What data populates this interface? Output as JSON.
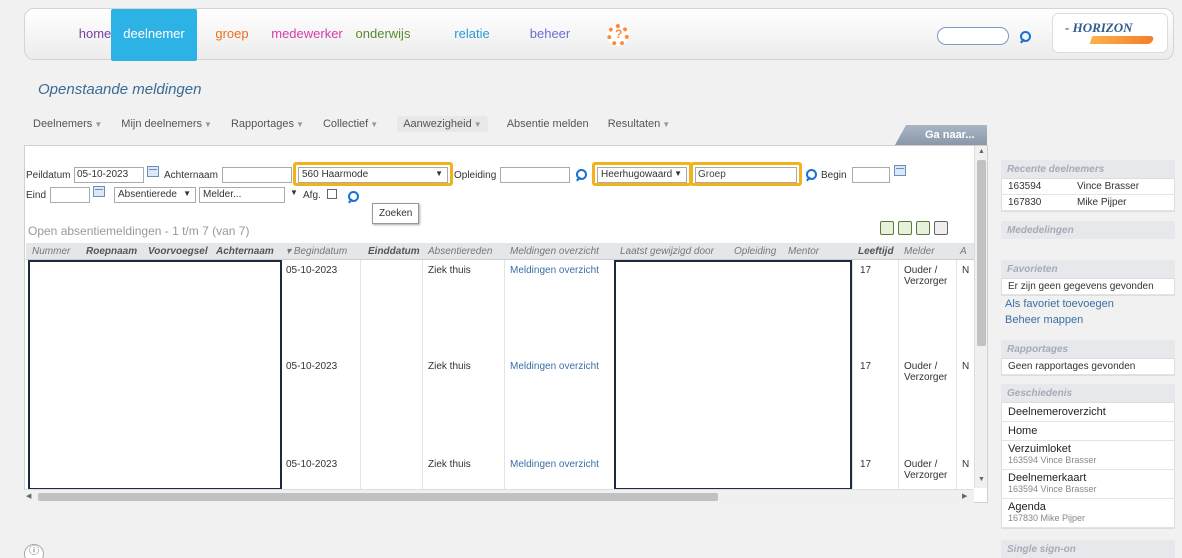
{
  "nav": {
    "items": [
      {
        "label": "home",
        "color": "#7a3fa8"
      },
      {
        "label": "deelnemer",
        "color": "#ffffff"
      },
      {
        "label": "groep",
        "color": "#e8711c"
      },
      {
        "label": "medewerker",
        "color": "#d23fa8"
      },
      {
        "label": "onderwijs",
        "color": "#5c8a2e"
      },
      {
        "label": "relatie",
        "color": "#2d9bd3"
      },
      {
        "label": "beheer",
        "color": "#6c6cd8"
      }
    ],
    "help_icon": "help-lifebuoy-icon",
    "search_placeholder": "",
    "logo_text": "- HORIZON"
  },
  "page": {
    "title": "Openstaande meldingen"
  },
  "subnav": {
    "items": [
      "Deelnemers",
      "Mijn deelnemers",
      "Rapportages",
      "Collectief",
      "Aanwezigheid",
      "Absentie melden",
      "Resultaten"
    ],
    "goto": "Ga naar..."
  },
  "filters": {
    "peildatum_label": "Peildatum",
    "peildatum_value": "05-10-2023",
    "achternaam_label": "Achternaam",
    "achternaam_value": "",
    "locatie_value": "560 Haarmode",
    "opleiding_label": "Opleiding",
    "vestiging_value": "Heerhugowaard",
    "groep_placeholder": "Groep",
    "begin_label": "Begin",
    "eind_label": "Eind",
    "absentiereden_value": "Absentierede",
    "melder_value": "Melder...",
    "afg_label": "Afg.",
    "tooltip": "Zoeken"
  },
  "list": {
    "title": "Open absentiemeldingen - 1 t/m 7 (van 7)",
    "columns": [
      "Nummer",
      "Roepnaam",
      "Voorvoegsel",
      "Achternaam",
      "Begindatum",
      "Einddatum",
      "Absentiereden",
      "Meldingen overzicht",
      "Laatst gewijzigd door",
      "Opleiding",
      "Mentor",
      "Leeftijd",
      "Melder",
      "A"
    ],
    "rows": [
      {
        "begindatum": "05-10-2023",
        "reden": "Ziek thuis",
        "overzicht": "Meldingen overzicht",
        "leeftijd": "17",
        "melder": "Ouder / Verzorger",
        "a": "N"
      },
      {
        "begindatum": "05-10-2023",
        "reden": "Ziek thuis",
        "overzicht": "Meldingen overzicht",
        "leeftijd": "17",
        "melder": "Ouder / Verzorger",
        "a": "N"
      },
      {
        "begindatum": "05-10-2023",
        "reden": "Ziek thuis",
        "overzicht": "Meldingen overzicht",
        "leeftijd": "17",
        "melder": "Ouder / Verzorger",
        "a": "N"
      }
    ]
  },
  "sidebar": {
    "recent_title": "Recente deelnemers",
    "recent": [
      {
        "nummer": "163594",
        "naam": "Vince Brasser"
      },
      {
        "nummer": "167830",
        "naam": "Mike Pijper"
      }
    ],
    "mededelingen_title": "Mededelingen",
    "favorieten_title": "Favorieten",
    "favorieten_empty": "Er zijn geen gegevens gevonden",
    "fav_add": "Als favoriet toevoegen",
    "fav_manage": "Beheer mappen",
    "rapportages_title": "Rapportages",
    "rapportages_empty": "Geen rapportages gevonden",
    "geschiedenis_title": "Geschiedenis",
    "history": [
      {
        "label": "Deelnemeroverzicht",
        "sub": ""
      },
      {
        "label": "Home",
        "sub": ""
      },
      {
        "label": "Verzuimloket",
        "sub": "163594 Vince Brasser"
      },
      {
        "label": "Deelnemerkaart",
        "sub": "163594 Vince Brasser"
      },
      {
        "label": "Agenda",
        "sub": "167830 Mike Pijper"
      }
    ],
    "sso_title": "Single sign-on"
  },
  "footer": {
    "info_icon": "ⓘ"
  }
}
